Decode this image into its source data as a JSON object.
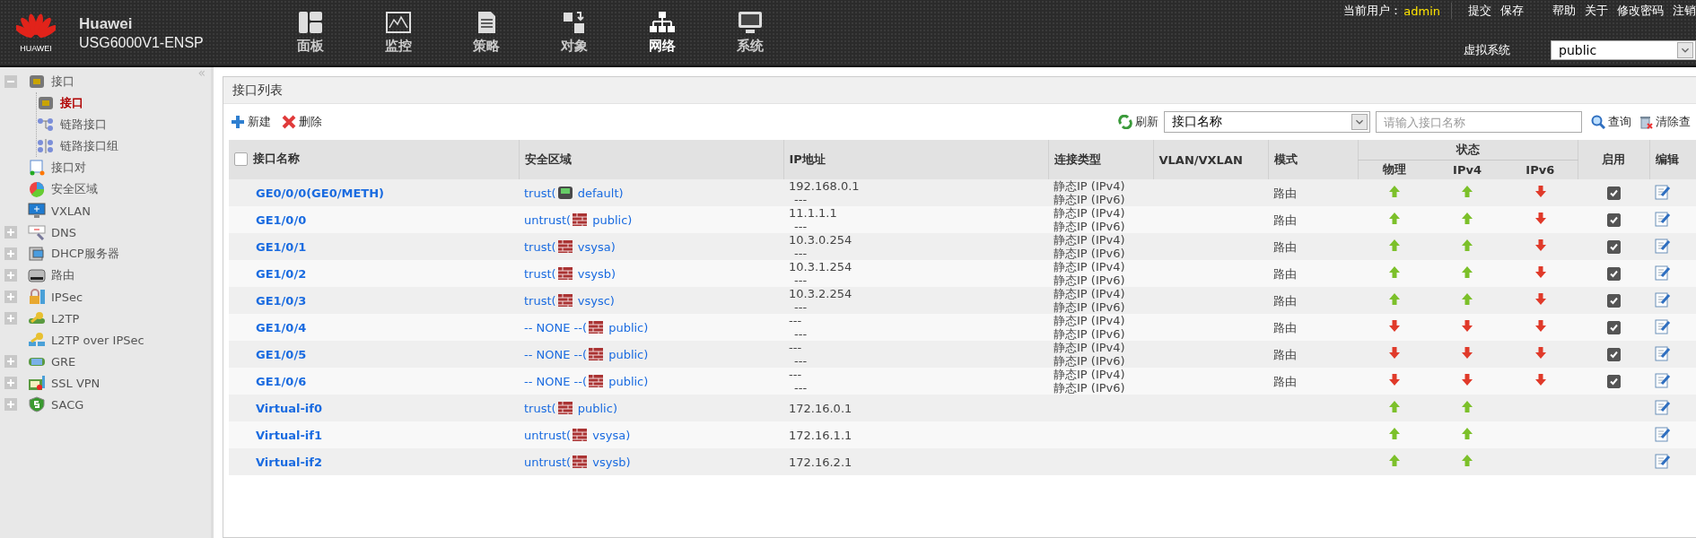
{
  "header": {
    "logo_text": "HUAWEI",
    "brand": "Huawei",
    "model": "USG6000V1-ENSP",
    "nav": [
      {
        "label": "面板",
        "selected": false
      },
      {
        "label": "监控",
        "selected": false
      },
      {
        "label": "策略",
        "selected": false
      },
      {
        "label": "对象",
        "selected": false
      },
      {
        "label": "网络",
        "selected": true
      },
      {
        "label": "系统",
        "selected": false
      }
    ],
    "user_label": "当前用户：",
    "user": "admin",
    "links_left": [
      "提交",
      "保存"
    ],
    "links_right": [
      "帮助",
      "关于",
      "修改密码",
      "注销"
    ],
    "vsys_label": "虚拟系统",
    "vsys_value": "public"
  },
  "sidebar": {
    "collapse": "«",
    "items": [
      {
        "label": "接口",
        "kind": "folder",
        "expanded": true,
        "selected": false,
        "children": [
          {
            "label": "接口",
            "selected": true
          },
          {
            "label": "链路接口",
            "selected": false
          },
          {
            "label": "链路接口组",
            "selected": false
          }
        ]
      },
      {
        "label": "接口对",
        "kind": "leaf",
        "selected": false
      },
      {
        "label": "安全区域",
        "kind": "leaf",
        "selected": false
      },
      {
        "label": "VXLAN",
        "kind": "leaf",
        "selected": false
      },
      {
        "label": "DNS",
        "kind": "folder",
        "expanded": false,
        "selected": false
      },
      {
        "label": "DHCP服务器",
        "kind": "folder",
        "expanded": false,
        "selected": false
      },
      {
        "label": "路由",
        "kind": "folder",
        "expanded": false,
        "selected": false
      },
      {
        "label": "IPSec",
        "kind": "folder",
        "expanded": false,
        "selected": false
      },
      {
        "label": "L2TP",
        "kind": "folder",
        "expanded": false,
        "selected": false
      },
      {
        "label": "L2TP over IPSec",
        "kind": "leaf",
        "selected": false
      },
      {
        "label": "GRE",
        "kind": "folder",
        "expanded": false,
        "selected": false
      },
      {
        "label": "SSL VPN",
        "kind": "folder",
        "expanded": false,
        "selected": false
      },
      {
        "label": "SACG",
        "kind": "folder",
        "expanded": false,
        "selected": false
      }
    ]
  },
  "panel": {
    "title": "接口列表",
    "toolbar": {
      "new": "新建",
      "delete": "删除",
      "refresh": "刷新",
      "filter_field": "接口名称",
      "search_placeholder": "请输入接口名称",
      "search": "查询",
      "clear": "清除查"
    },
    "table": {
      "select_all": {
        "checked": false
      },
      "columns": [
        "接口名称",
        "安全区域",
        "IP地址",
        "连接类型",
        "VLAN/VXLAN",
        "模式"
      ],
      "status_group": "状态",
      "status_columns": [
        "物理",
        "IPv4",
        "IPv6"
      ],
      "enable_column": "启用",
      "edit_column": "编辑",
      "rows": [
        {
          "name": "GE0/0/0(GE0/METH)",
          "zone": "trust(",
          "vsys": "default)",
          "kind": "root",
          "ip": [
            "192.168.0.1",
            "---"
          ],
          "conn": [
            "静态IP (IPv4)",
            "静态IP (IPv6)"
          ],
          "mode": "路由",
          "physical_up": true,
          "ipv4_up": true,
          "ipv6_up": false,
          "enabled": true
        },
        {
          "name": "GE1/0/0",
          "zone": "untrust(",
          "vsys": "public)",
          "kind": "vsys",
          "ip": [
            "11.1.1.1",
            "---"
          ],
          "conn": [
            "静态IP (IPv4)",
            "静态IP (IPv6)"
          ],
          "mode": "路由",
          "physical_up": true,
          "ipv4_up": true,
          "ipv6_up": false,
          "enabled": true
        },
        {
          "name": "GE1/0/1",
          "zone": "trust(",
          "vsys": "vsysa)",
          "kind": "vsys",
          "ip": [
            "10.3.0.254",
            "---"
          ],
          "conn": [
            "静态IP (IPv4)",
            "静态IP (IPv6)"
          ],
          "mode": "路由",
          "physical_up": true,
          "ipv4_up": true,
          "ipv6_up": false,
          "enabled": true
        },
        {
          "name": "GE1/0/2",
          "zone": "trust(",
          "vsys": "vsysb)",
          "kind": "vsys",
          "ip": [
            "10.3.1.254",
            "---"
          ],
          "conn": [
            "静态IP (IPv4)",
            "静态IP (IPv6)"
          ],
          "mode": "路由",
          "physical_up": true,
          "ipv4_up": true,
          "ipv6_up": false,
          "enabled": true
        },
        {
          "name": "GE1/0/3",
          "zone": "trust(",
          "vsys": "vsysc)",
          "kind": "vsys",
          "ip": [
            "10.3.2.254",
            "---"
          ],
          "conn": [
            "静态IP (IPv4)",
            "静态IP (IPv6)"
          ],
          "mode": "路由",
          "physical_up": true,
          "ipv4_up": true,
          "ipv6_up": false,
          "enabled": true
        },
        {
          "name": "GE1/0/4",
          "zone": "-- NONE --(",
          "vsys": "public)",
          "kind": "vsys",
          "ip": [
            "---",
            "---"
          ],
          "conn": [
            "静态IP (IPv4)",
            "静态IP (IPv6)"
          ],
          "mode": "路由",
          "physical_up": false,
          "ipv4_up": false,
          "ipv6_up": false,
          "enabled": true
        },
        {
          "name": "GE1/0/5",
          "zone": "-- NONE --(",
          "vsys": "public)",
          "kind": "vsys",
          "ip": [
            "---",
            "---"
          ],
          "conn": [
            "静态IP (IPv4)",
            "静态IP (IPv6)"
          ],
          "mode": "路由",
          "physical_up": false,
          "ipv4_up": false,
          "ipv6_up": false,
          "enabled": true
        },
        {
          "name": "GE1/0/6",
          "zone": "-- NONE --(",
          "vsys": "public)",
          "kind": "vsys",
          "ip": [
            "---",
            "---"
          ],
          "conn": [
            "静态IP (IPv4)",
            "静态IP (IPv6)"
          ],
          "mode": "路由",
          "physical_up": false,
          "ipv4_up": false,
          "ipv6_up": false,
          "enabled": true
        },
        {
          "name": "Virtual-if0",
          "zone": "trust(",
          "vsys": "public)",
          "kind": "vsys",
          "ip": [
            "172.16.0.1"
          ],
          "physical_up": true,
          "ipv4_up": true
        },
        {
          "name": "Virtual-if1",
          "zone": "untrust(",
          "vsys": "vsysa)",
          "kind": "vsys",
          "ip": [
            "172.16.1.1"
          ],
          "physical_up": true,
          "ipv4_up": true
        },
        {
          "name": "Virtual-if2",
          "zone": "untrust(",
          "vsys": "vsysb)",
          "kind": "vsys",
          "ip": [
            "172.16.2.1"
          ],
          "physical_up": true,
          "ipv4_up": true
        }
      ]
    }
  }
}
